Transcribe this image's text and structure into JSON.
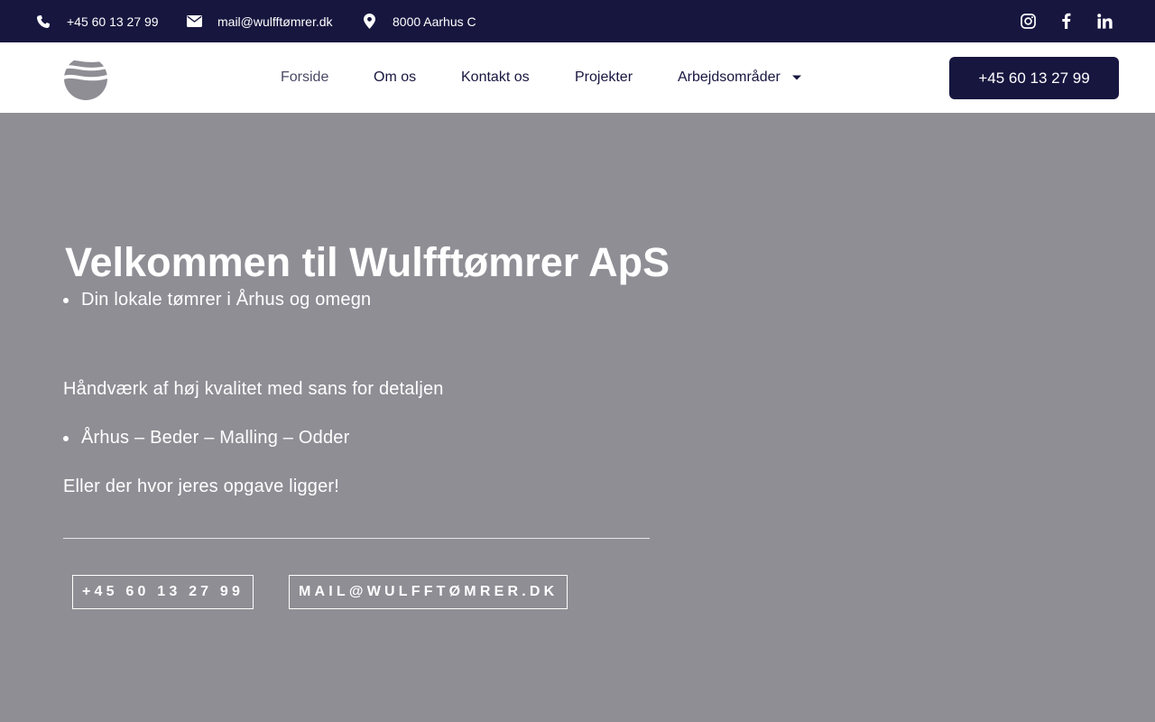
{
  "topbar": {
    "phone": "+45 60 13 27 99",
    "email": "mail@wulfftømrer.dk",
    "location": "8000 Aarhus C",
    "icons": {
      "phone": "phone-icon",
      "email": "envelope-icon",
      "location": "map-pin-icon",
      "social": [
        "instagram-icon",
        "facebook-icon",
        "linkedin-icon"
      ]
    }
  },
  "header": {
    "nav": {
      "forside": "Forside",
      "om_os": "Om os",
      "kontakt": "Kontakt os",
      "projekter": "Projekter",
      "omraader": "Arbejdsområder"
    },
    "cta_phone": "+45 60 13 27 99"
  },
  "hero": {
    "title": "Velkommen til Wulfftømrer ApS",
    "bullet1": "Din lokale tømrer i Århus og omegn",
    "para1": "Håndværk af høj kvalitet med sans for detaljen",
    "bullet2": "Århus – Beder – Malling – Odder",
    "para2": "Eller der hvor jeres opgave ligger!",
    "btn_phone": "+45 60 13 27 99",
    "btn_mail": "MAIL@WULFFTØMRER.DK"
  },
  "colors": {
    "brand_navy": "#17163f",
    "hero_overlay": "#8f8e95",
    "white": "#ffffff"
  }
}
